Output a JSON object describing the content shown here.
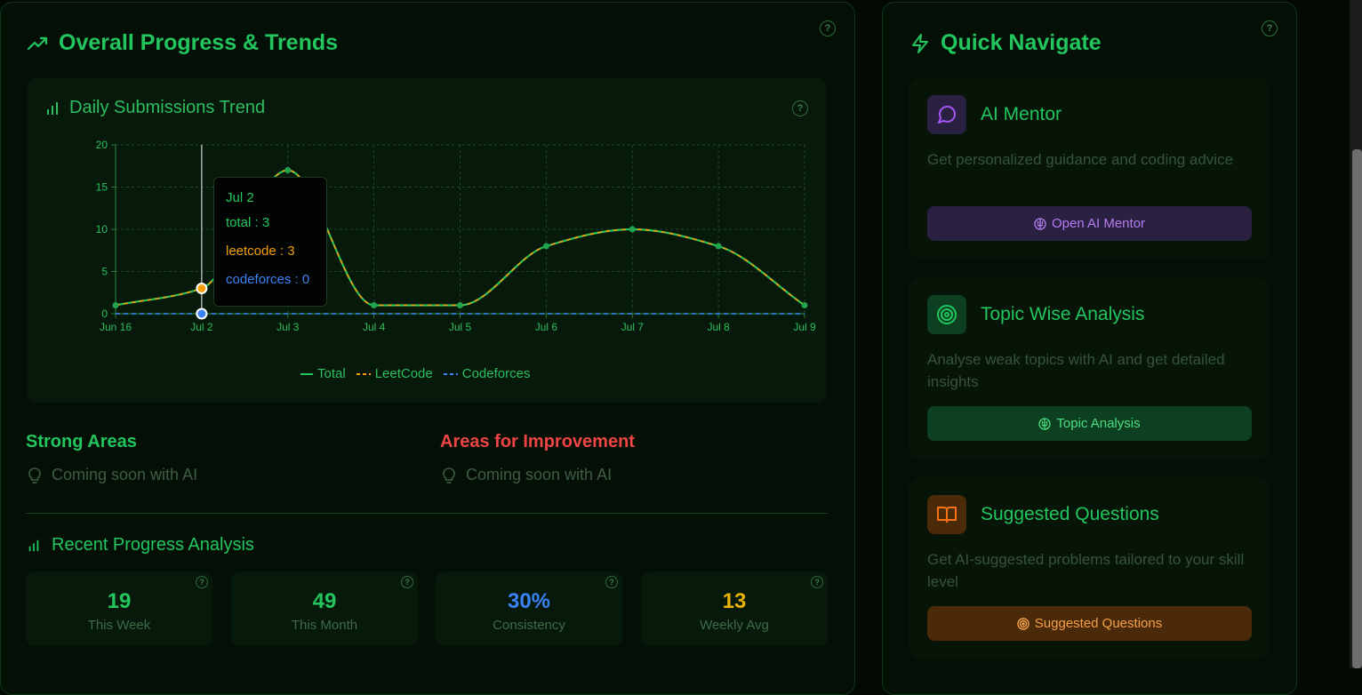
{
  "overall": {
    "title": "Overall Progress & Trends",
    "help": "?"
  },
  "chart_card": {
    "title": "Daily Submissions Trend",
    "help": "?"
  },
  "chart_data": {
    "type": "line",
    "title": "Daily Submissions Trend",
    "x": [
      "Jun 16",
      "Jul 2",
      "Jul 3",
      "Jul 4",
      "Jul 5",
      "Jul 6",
      "Jul 7",
      "Jul 8",
      "Jul 9"
    ],
    "series": [
      {
        "name": "Total",
        "values": [
          1,
          3,
          17,
          1,
          1,
          8,
          10,
          8,
          1
        ],
        "color": "#22c55e",
        "dash": "solid"
      },
      {
        "name": "LeetCode",
        "values": [
          1,
          3,
          17,
          1,
          1,
          8,
          10,
          8,
          1
        ],
        "color": "#f59e0b",
        "dash": "dashed"
      },
      {
        "name": "Codeforces",
        "values": [
          0,
          0,
          0,
          0,
          0,
          0,
          0,
          0,
          0
        ],
        "color": "#3b82f6",
        "dash": "dashed"
      }
    ],
    "ylim": [
      0,
      20
    ],
    "yticks": [
      0,
      5,
      10,
      15,
      20
    ],
    "grid": true,
    "legend": "bottom-center",
    "active_index": 1
  },
  "tooltip": {
    "date": "Jul 2",
    "total": "total : 3",
    "leetcode": "leetcode : 3",
    "codeforces": "codeforces : 0"
  },
  "legend": {
    "total": "Total",
    "leetcode": "LeetCode",
    "codeforces": "Codeforces"
  },
  "strong": {
    "title": "Strong Areas",
    "text": "Coming soon with AI"
  },
  "improve": {
    "title": "Areas for Improvement",
    "text": "Coming soon with AI"
  },
  "recent": {
    "title": "Recent Progress Analysis",
    "stats": [
      {
        "value": "19",
        "label": "This Week",
        "color": "#22c55e"
      },
      {
        "value": "49",
        "label": "This Month",
        "color": "#22c55e"
      },
      {
        "value": "30%",
        "label": "Consistency",
        "color": "#3b82f6"
      },
      {
        "value": "13",
        "label": "Weekly Avg",
        "color": "#eab308"
      }
    ]
  },
  "quick": {
    "title": "Quick Navigate",
    "help": "?",
    "cards": [
      {
        "title": "AI Mentor",
        "desc": "Get personalized guidance and coding advice",
        "button": "Open AI Mentor"
      },
      {
        "title": "Topic Wise Analysis",
        "desc": "Analyse weak topics with AI and get detailed insights",
        "button": "Topic Analysis"
      },
      {
        "title": "Suggested Questions",
        "desc": "Get AI-suggested problems tailored to your skill level",
        "button": "Suggested Questions"
      }
    ]
  }
}
